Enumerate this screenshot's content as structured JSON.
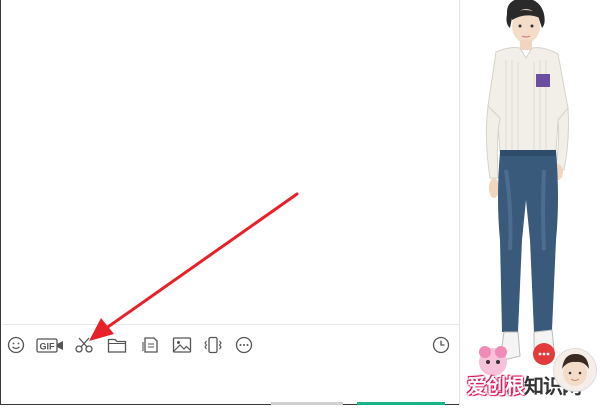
{
  "toolbar": {
    "icons": [
      "emoji-icon",
      "gif-icon",
      "screenshot-scissors-icon",
      "folder-icon",
      "file-icon",
      "image-icon",
      "shake-icon",
      "more-icon",
      "history-clock-icon"
    ],
    "gif_label": "GIF"
  },
  "watermark": {
    "part1": "爱创根",
    "part2": "知识网"
  },
  "colors": {
    "arrow": "#e8202a",
    "send_button": "#19b38a",
    "brand_pink": "#d81e5b"
  }
}
